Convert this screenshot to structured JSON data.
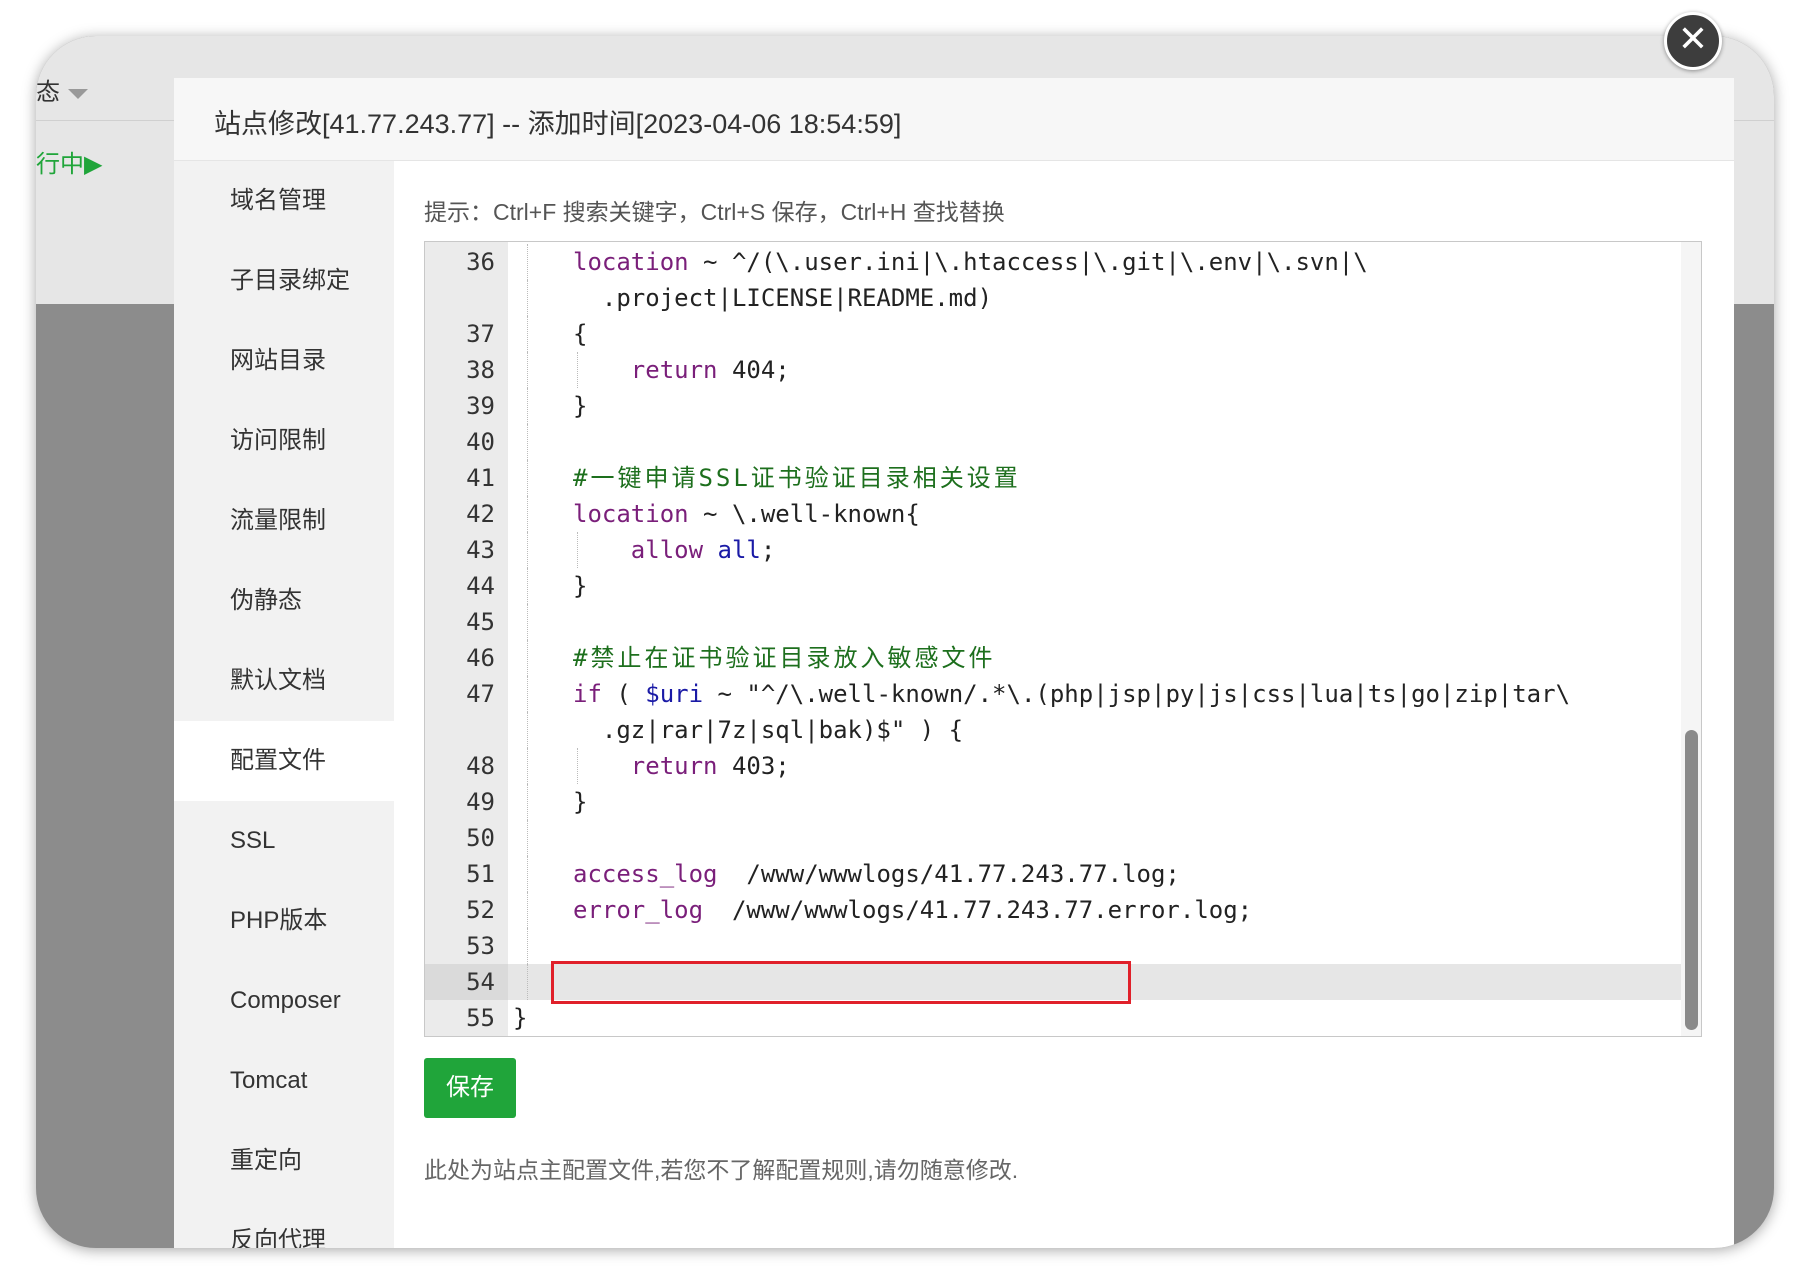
{
  "background": {
    "status_dropdown_label": "态",
    "running_status": "行中▶"
  },
  "modal": {
    "title": "站点修改[41.77.243.77] -- 添加时间[2023-04-06 18:54:59]",
    "close_symbol": "✕"
  },
  "sidebar": {
    "items": [
      {
        "label": "域名管理",
        "active": false
      },
      {
        "label": "子目录绑定",
        "active": false
      },
      {
        "label": "网站目录",
        "active": false
      },
      {
        "label": "访问限制",
        "active": false
      },
      {
        "label": "流量限制",
        "active": false
      },
      {
        "label": "伪静态",
        "active": false
      },
      {
        "label": "默认文档",
        "active": false
      },
      {
        "label": "配置文件",
        "active": true
      },
      {
        "label": "SSL",
        "active": false
      },
      {
        "label": "PHP版本",
        "active": false
      },
      {
        "label": "Composer",
        "active": false
      },
      {
        "label": "Tomcat",
        "active": false
      },
      {
        "label": "重定向",
        "active": false
      },
      {
        "label": "反向代理",
        "active": false
      }
    ]
  },
  "content": {
    "tip": "提示：Ctrl+F 搜索关键字，Ctrl+S 保存，Ctrl+H 查找替换",
    "save_label": "保存",
    "note": "此处为站点主配置文件,若您不了解配置规则,请勿随意修改."
  },
  "editor": {
    "current_line": 54,
    "lines": [
      {
        "num": "36",
        "text": "location ~ ^/(\\.user.ini|\\.htaccess|\\.git|\\.env|\\.svn|\\"
      },
      {
        "num": "",
        "text": "  .project|LICENSE|README.md)"
      },
      {
        "num": "37",
        "text": "{"
      },
      {
        "num": "38",
        "text": "    return 404;"
      },
      {
        "num": "39",
        "text": "}"
      },
      {
        "num": "40",
        "text": ""
      },
      {
        "num": "41",
        "text": "#一键申请SSL证书验证目录相关设置"
      },
      {
        "num": "42",
        "text": "location ~ \\.well-known{"
      },
      {
        "num": "43",
        "text": "    allow all;"
      },
      {
        "num": "44",
        "text": "}"
      },
      {
        "num": "45",
        "text": ""
      },
      {
        "num": "46",
        "text": "#禁止在证书验证目录放入敏感文件"
      },
      {
        "num": "47",
        "text": "if ( $uri ~ \"^/\\.well-known/.*\\.(php|jsp|py|js|css|lua|ts|go|zip|tar\\"
      },
      {
        "num": "",
        "text": "  .gz|rar|7z|sql|bak)$\" ) {"
      },
      {
        "num": "48",
        "text": "    return 403;"
      },
      {
        "num": "49",
        "text": "}"
      },
      {
        "num": "50",
        "text": ""
      },
      {
        "num": "51",
        "text": "access_log  /www/wwwlogs/41.77.243.77.log;"
      },
      {
        "num": "52",
        "text": "error_log  /www/wwwlogs/41.77.243.77.error.log;"
      },
      {
        "num": "53",
        "text": ""
      },
      {
        "num": "54",
        "text": ""
      },
      {
        "num": "55",
        "text": "}"
      }
    ]
  },
  "colors": {
    "accent_green": "#20a53a",
    "highlight_red": "#e0202a",
    "keyword": "#7a1f7a",
    "variable": "#1a1aa6",
    "comment": "#1d6f1d"
  }
}
